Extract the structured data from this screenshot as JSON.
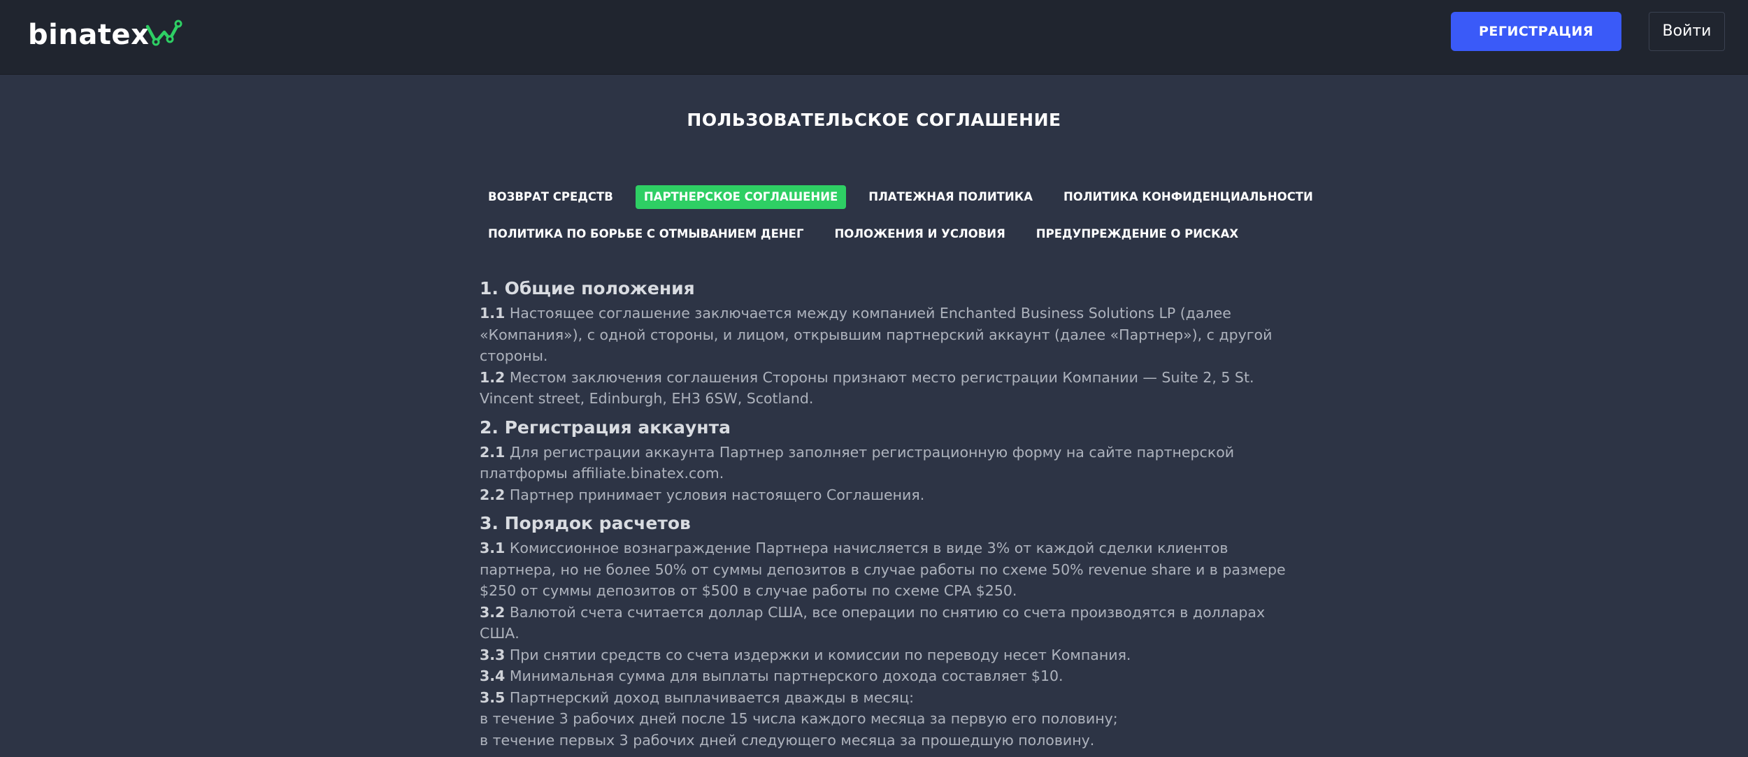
{
  "header": {
    "logo_text": "binatex",
    "register_label": "РЕГИСТРАЦИЯ",
    "login_label": "Войти",
    "logo_accent_color": "#2ecf64"
  },
  "page_title": "ПОЛЬЗОВАТЕЛЬСКОЕ СОГЛАШЕНИЕ",
  "tabs": {
    "row1": [
      {
        "label": "ВОЗВРАТ СРЕДСТВ",
        "active": false
      },
      {
        "label": "ПАРТНЕРСКОЕ СОГЛАШЕНИЕ",
        "active": true
      },
      {
        "label": "ПЛАТЕЖНАЯ ПОЛИТИКА",
        "active": false
      },
      {
        "label": "ПОЛИТИКА КОНФИДЕНЦИАЛЬНОСТИ",
        "active": false
      }
    ],
    "row2": [
      {
        "label": "ПОЛИТИКА ПО БОРЬБЕ С ОТМЫВАНИЕМ ДЕНЕГ",
        "active": false
      },
      {
        "label": "ПОЛОЖЕНИЯ И УСЛОВИЯ",
        "active": false
      },
      {
        "label": "ПРЕДУПРЕЖДЕНИЕ О РИСКАХ",
        "active": false
      }
    ]
  },
  "sections": [
    {
      "title": "1. Общие положения",
      "items": [
        {
          "num": "1.1",
          "text": " Настоящее соглашение заключается между компанией Enchanted Business Solutions LP (далее «Компания»), с одной стороны, и лицом, открывшим партнерский аккаунт (далее «Партнер»), с другой стороны."
        },
        {
          "num": "1.2",
          "text": " Местом заключения соглашения Стороны признают место регистрации Компании — Suite 2, 5 St. Vincent street, Edinburgh, EH3 6SW, Scotland."
        }
      ]
    },
    {
      "title": "2. Регистрация аккаунта",
      "items": [
        {
          "num": "2.1",
          "text": " Для регистрации аккаунта Партнер заполняет регистрационную форму на сайте партнерской платформы affiliate.binatex.com."
        },
        {
          "num": "2.2",
          "text": " Партнер принимает условия настоящего Соглашения."
        }
      ]
    },
    {
      "title": "3. Порядок расчетов",
      "items": [
        {
          "num": "3.1",
          "text": " Комиссионное вознаграждение Партнера начисляется в виде 3% от каждой сделки клиентов партнера, но не более 50% от суммы депозитов в случае работы по схеме 50% revenue share и в размере $250 от суммы депозитов от $500 в случае работы по схеме CPA $250."
        },
        {
          "num": "3.2",
          "text": " Валютой счета считается доллар США, все операции по снятию со счета производятся в долларах США."
        },
        {
          "num": "3.3",
          "text": " При снятии средств со счета издержки и комиссии по переводу несет Компания."
        },
        {
          "num": "3.4",
          "text": " Минимальная сумма для выплаты партнерского дохода составляет $10."
        },
        {
          "num": "3.5",
          "text": " Партнерский доход выплачивается дважды в месяц:"
        }
      ],
      "extra_lines": [
        "в течение 3 рабочих дней после 15 числа каждого месяца за первую его половину;",
        "в течение первых 3 рабочих дней следующего месяца за прошедшую половину."
      ]
    }
  ]
}
